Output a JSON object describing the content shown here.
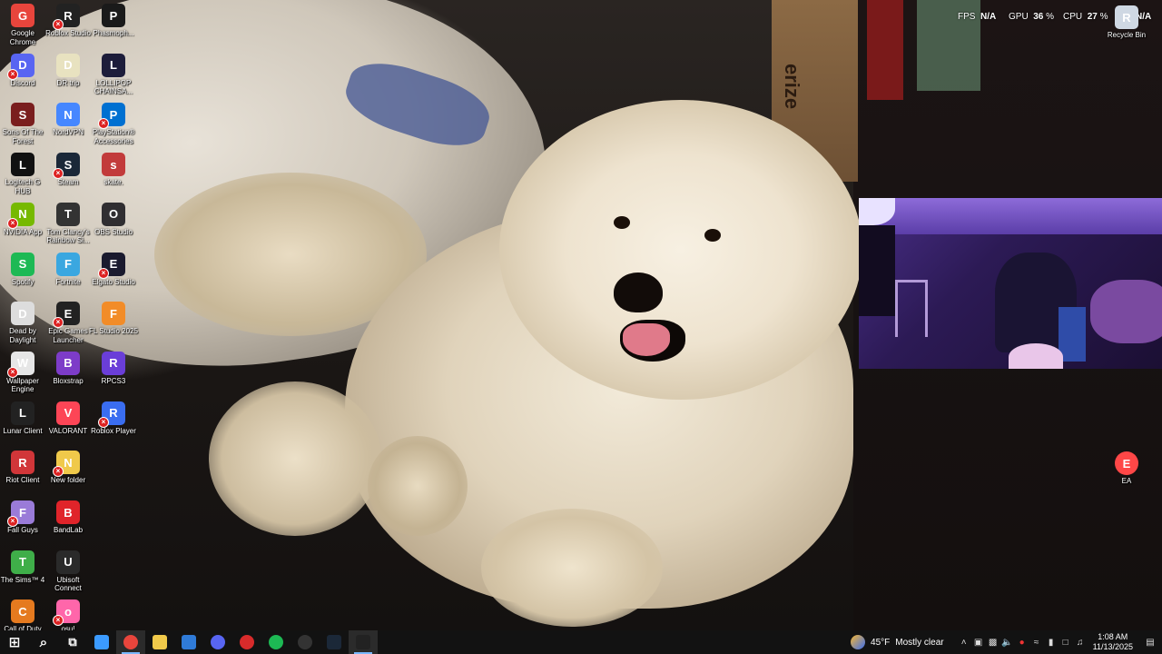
{
  "overlay": {
    "fps_label": "FPS",
    "fps_value": "N/A",
    "gpu_label": "GPU",
    "gpu_value": "36",
    "cpu_label": "CPU",
    "cpu_value": "27",
    "unit": "%",
    "extra_value": "N/A"
  },
  "wallpaper": {
    "box_text": "erize"
  },
  "desktop_icons_left": [
    {
      "label": "Google Chrome",
      "icon": "chrome-icon",
      "color": "#e8453c"
    },
    {
      "label": "Discord",
      "icon": "discord-icon",
      "color": "#5865f2"
    },
    {
      "label": "Sons Of The Forest",
      "icon": "sons-of-the-forest-icon",
      "color": "#7a1e1e"
    },
    {
      "label": "Logitech G HUB",
      "icon": "logitech-icon",
      "color": "#111111"
    },
    {
      "label": "NVIDIA App",
      "icon": "nvidia-icon",
      "color": "#76b900"
    },
    {
      "label": "Spotify",
      "icon": "spotify-icon",
      "color": "#1db954"
    },
    {
      "label": "Dead by Daylight",
      "icon": "dead-by-daylight-icon",
      "color": "#dddddd"
    },
    {
      "label": "Wallpaper Engine",
      "icon": "wallpaper-engine-icon",
      "color": "#e6e6e6"
    },
    {
      "label": "Lunar Client",
      "icon": "lunar-client-icon",
      "color": "#222222"
    },
    {
      "label": "Riot Client",
      "icon": "riot-client-icon",
      "color": "#d13639"
    },
    {
      "label": "Fall Guys",
      "icon": "fall-guys-icon",
      "color": "#9a7bd8"
    },
    {
      "label": "The Sims™ 4",
      "icon": "sims-icon",
      "color": "#3fae49"
    },
    {
      "label": "Call of Duty",
      "icon": "call-of-duty-icon",
      "color": "#e57a1f"
    }
  ],
  "desktop_icons_mid": [
    {
      "label": "Roblox Studio",
      "icon": "roblox-studio-icon",
      "color": "#222222"
    },
    {
      "label": "DR trip",
      "icon": "dr-trip-icon",
      "color": "#e8e2c0"
    },
    {
      "label": "NordVPN",
      "icon": "nordvpn-icon",
      "color": "#4687ff"
    },
    {
      "label": "Steam",
      "icon": "steam-icon",
      "color": "#1b2838"
    },
    {
      "label": "Tom Clancy's Rainbow Si...",
      "icon": "rainbow-six-icon",
      "color": "#333333"
    },
    {
      "label": "Fortnite",
      "icon": "fortnite-icon",
      "color": "#3aa7e0"
    },
    {
      "label": "Epic Games Launcher",
      "icon": "epic-games-icon",
      "color": "#222222"
    },
    {
      "label": "Bloxstrap",
      "icon": "bloxstrap-icon",
      "color": "#7d3cc8"
    },
    {
      "label": "VALORANT",
      "icon": "valorant-icon",
      "color": "#fd4556"
    },
    {
      "label": "New folder",
      "icon": "folder-icon",
      "color": "#f0c94a"
    },
    {
      "label": "BandLab",
      "icon": "bandlab-icon",
      "color": "#e0242a"
    },
    {
      "label": "Ubisoft Connect",
      "icon": "ubisoft-icon",
      "color": "#2a2a2a"
    },
    {
      "label": "osu!",
      "icon": "osu-icon",
      "color": "#ff66aa"
    }
  ],
  "desktop_icons_right": [
    {
      "label": "Phasmoph...",
      "icon": "phasmophobia-icon",
      "color": "#1a1a1a"
    },
    {
      "label": "LOLLIPOP CHAINSA...",
      "icon": "lollipop-chainsaw-icon",
      "color": "#1d1d3a"
    },
    {
      "label": "PlayStation® Accessories",
      "icon": "playstation-icon",
      "color": "#0070d1"
    },
    {
      "label": "skate.",
      "icon": "skate-icon",
      "color": "#c23b3b"
    },
    {
      "label": "OBS Studio",
      "icon": "obs-icon",
      "color": "#302e31"
    },
    {
      "label": "Elgato Studio",
      "icon": "elgato-icon",
      "color": "#1a1a2e"
    },
    {
      "label": "FL Studio 2025",
      "icon": "fl-studio-icon",
      "color": "#f28c28"
    },
    {
      "label": "RPCS3",
      "icon": "rpcs3-icon",
      "color": "#6a3ed8"
    },
    {
      "label": "Roblox Player",
      "icon": "roblox-player-icon",
      "color": "#3a6df0"
    }
  ],
  "desktop_icons_far_right": [
    {
      "label": "Recycle Bin",
      "icon": "recycle-bin-icon",
      "color": "#cfd8e3"
    },
    {
      "label": "EA",
      "icon": "ea-icon",
      "color": "#ff4747"
    }
  ],
  "taskbar": {
    "apps": [
      {
        "name": "start-button",
        "icon": "windows-icon",
        "color": "#ffffff"
      },
      {
        "name": "search-button",
        "icon": "search-icon",
        "color": "#ffffff"
      },
      {
        "name": "task-view-button",
        "icon": "task-view-icon",
        "color": "#ffffff"
      },
      {
        "name": "taskbar-copilot",
        "icon": "copilot-icon",
        "color": "#3b9bff"
      },
      {
        "name": "taskbar-chrome",
        "icon": "chrome-icon",
        "color": "#e8453c"
      },
      {
        "name": "taskbar-file-explorer",
        "icon": "folder-icon",
        "color": "#f0c94a"
      },
      {
        "name": "taskbar-store",
        "icon": "store-icon",
        "color": "#2f7bd8"
      },
      {
        "name": "taskbar-discord",
        "icon": "discord-icon",
        "color": "#5865f2"
      },
      {
        "name": "taskbar-app-red",
        "icon": "red-app-icon",
        "color": "#d82b2b"
      },
      {
        "name": "taskbar-spotify",
        "icon": "spotify-icon",
        "color": "#1db954"
      },
      {
        "name": "taskbar-app-dark",
        "icon": "dark-app-icon",
        "color": "#333333"
      },
      {
        "name": "taskbar-steam",
        "icon": "steam-icon",
        "color": "#1b2838"
      },
      {
        "name": "taskbar-epic",
        "icon": "epic-games-icon",
        "color": "#222222"
      }
    ],
    "weather": {
      "temp": "45°F",
      "condition": "Mostly clear"
    },
    "time": "1:08 AM",
    "date": "11/13/2025"
  }
}
